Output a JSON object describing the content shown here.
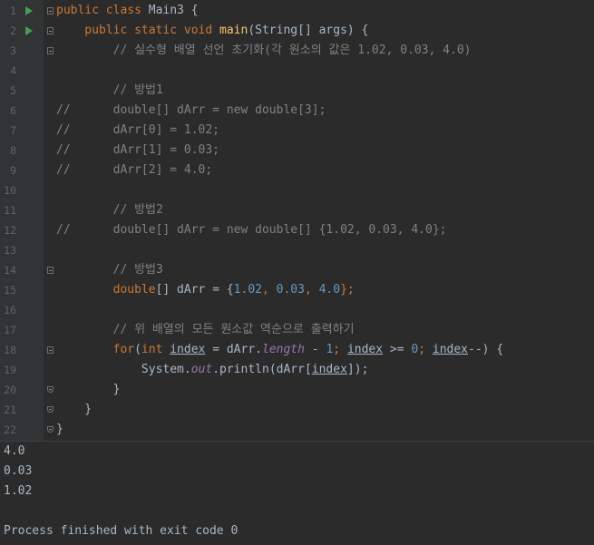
{
  "editor": {
    "lines": [
      {
        "num": "1",
        "run": true,
        "fold": "start",
        "parts": [
          {
            "t": "public class ",
            "c": "kw"
          },
          {
            "t": "Main3 {",
            "c": "pl"
          }
        ]
      },
      {
        "num": "2",
        "run": true,
        "fold": "start",
        "parts": [
          {
            "t": "    public static void ",
            "c": "kw"
          },
          {
            "t": "main",
            "c": "fn"
          },
          {
            "t": "(String[] args) {",
            "c": "pl"
          }
        ]
      },
      {
        "num": "3",
        "fold": "start",
        "parts": [
          {
            "t": "        // 실수형 배열 선언 초기화(각 원소의 값은 1.02, 0.03, 4.0)",
            "c": "cm"
          }
        ]
      },
      {
        "num": "4",
        "parts": []
      },
      {
        "num": "5",
        "parts": [
          {
            "t": "        // 방법1",
            "c": "cm"
          }
        ]
      },
      {
        "num": "6",
        "parts": [
          {
            "t": "//      double[] dArr = new double[3];",
            "c": "cm"
          }
        ]
      },
      {
        "num": "7",
        "parts": [
          {
            "t": "//      dArr[0] = 1.02;",
            "c": "cm"
          }
        ]
      },
      {
        "num": "8",
        "parts": [
          {
            "t": "//      dArr[1] = 0.03;",
            "c": "cm"
          }
        ]
      },
      {
        "num": "9",
        "parts": [
          {
            "t": "//      dArr[2] = 4.0;",
            "c": "cm"
          }
        ]
      },
      {
        "num": "10",
        "parts": []
      },
      {
        "num": "11",
        "parts": [
          {
            "t": "        // 방법2",
            "c": "cm"
          }
        ]
      },
      {
        "num": "12",
        "parts": [
          {
            "t": "//      double[] dArr = new double[] {1.02, 0.03, 4.0};",
            "c": "cm"
          }
        ]
      },
      {
        "num": "13",
        "parts": []
      },
      {
        "num": "14",
        "fold": "start",
        "parts": [
          {
            "t": "        // 방법3",
            "c": "cm"
          }
        ]
      },
      {
        "num": "15",
        "parts": [
          {
            "t": "        double",
            "c": "kw"
          },
          {
            "t": "[] dArr = {",
            "c": "pl"
          },
          {
            "t": "1.02",
            "c": "num"
          },
          {
            "t": ", ",
            "c": "kw"
          },
          {
            "t": "0.03",
            "c": "num"
          },
          {
            "t": ", ",
            "c": "kw"
          },
          {
            "t": "4.0",
            "c": "num"
          },
          {
            "t": "};",
            "c": "kw"
          }
        ]
      },
      {
        "num": "16",
        "parts": []
      },
      {
        "num": "17",
        "parts": [
          {
            "t": "        // 위 배열의 모든 원소값 역순으로 출력하기",
            "c": "cm"
          }
        ]
      },
      {
        "num": "18",
        "fold": "start",
        "parts": [
          {
            "t": "        for",
            "c": "kw"
          },
          {
            "t": "(",
            "c": "pl"
          },
          {
            "t": "int ",
            "c": "kw"
          },
          {
            "t": "index",
            "c": "pl ul"
          },
          {
            "t": " = dArr.",
            "c": "pl"
          },
          {
            "t": "length",
            "c": "st"
          },
          {
            "t": " - ",
            "c": "pl"
          },
          {
            "t": "1",
            "c": "num"
          },
          {
            "t": "; ",
            "c": "kw"
          },
          {
            "t": "index",
            "c": "pl ul"
          },
          {
            "t": " >= ",
            "c": "pl"
          },
          {
            "t": "0",
            "c": "num"
          },
          {
            "t": "; ",
            "c": "kw"
          },
          {
            "t": "index",
            "c": "pl ul"
          },
          {
            "t": "--) {",
            "c": "pl"
          }
        ]
      },
      {
        "num": "19",
        "cursor": true,
        "parts": [
          {
            "t": "            System.",
            "c": "pl"
          },
          {
            "t": "out",
            "c": "st"
          },
          {
            "t": ".println(dArr[",
            "c": "pl"
          },
          {
            "t": "index",
            "c": "pl ul"
          },
          {
            "t": "]);",
            "c": "pl"
          }
        ]
      },
      {
        "num": "20",
        "fold": "end",
        "parts": [
          {
            "t": "        }",
            "c": "pl"
          }
        ]
      },
      {
        "num": "21",
        "fold": "end",
        "parts": [
          {
            "t": "    }",
            "c": "pl"
          }
        ]
      },
      {
        "num": "22",
        "fold": "end",
        "parts": [
          {
            "t": "}",
            "c": "pl"
          }
        ]
      }
    ]
  },
  "console": {
    "out1": "4.0",
    "out2": "0.03",
    "out3": "1.02",
    "exit": "Process finished with exit code 0"
  }
}
